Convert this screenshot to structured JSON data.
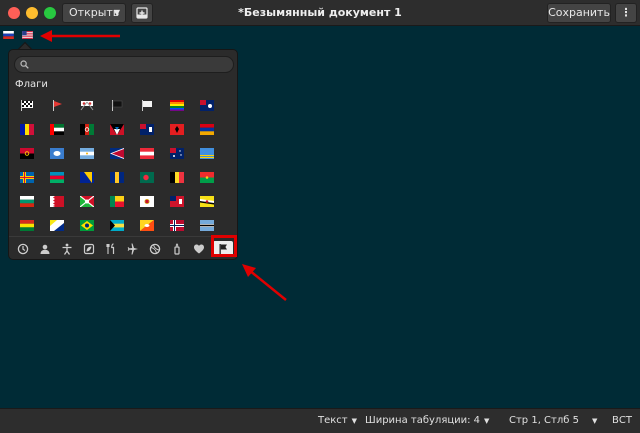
{
  "header": {
    "open_label": "Открыть",
    "title": "*Безымянный документ 1",
    "save_label": "Сохранить",
    "menu_label": "⋮"
  },
  "editor": {
    "typed_flags": [
      "ru-flag-icon",
      "us-flag-icon"
    ],
    "background_color": "#002b36"
  },
  "emoji_picker": {
    "search_placeholder": "",
    "section_title": "Флаги",
    "categories": [
      "recent-icon",
      "person-icon",
      "body-icon",
      "nature-icon",
      "food-icon",
      "travel-icon",
      "activities-icon",
      "objects-icon",
      "symbols-icon",
      "flags-icon"
    ],
    "active_category": "flags-icon"
  },
  "statusbar": {
    "syntax_label": "Текст",
    "tab_width_label": "Ширина табуляции: 4",
    "cursor_position": "Стр 1, Стлб 5",
    "insert_mode": "ВСТ"
  },
  "colors": {
    "annotation_red": "#e00000",
    "header_bg": "#2d2d2d"
  }
}
